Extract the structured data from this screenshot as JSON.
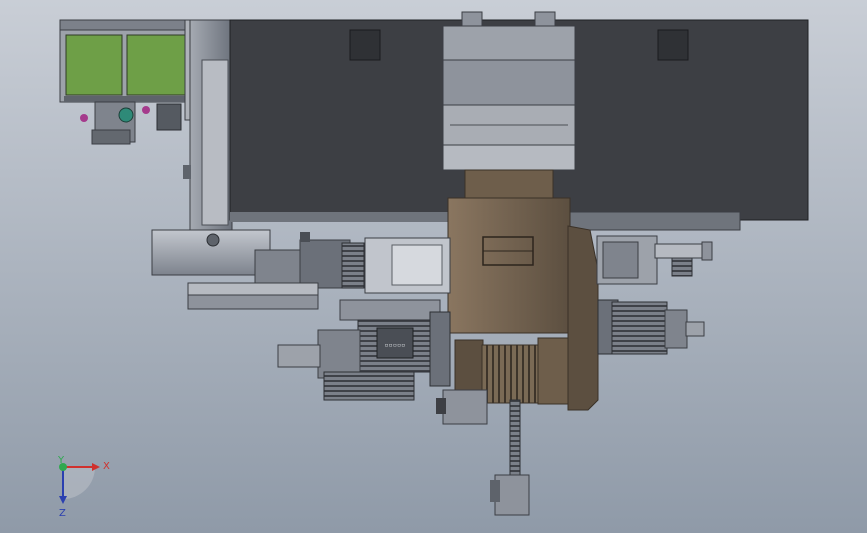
{
  "viewport": {
    "background_top": "#c9ced6",
    "background_bottom": "#8f9aa8"
  },
  "triad": {
    "x_label": "X",
    "y_label": "Y",
    "z_label": "Z",
    "x_color": "#d0312d",
    "y_color": "#2fa84f",
    "z_color": "#2a3fb0"
  },
  "colors": {
    "housing_dark": "#3d3f44",
    "housing_steel": "#8e939c",
    "housing_light": "#b6bac1",
    "gearbox_brown": "#6e5e4b",
    "gearbox_brown_dark": "#4e4336",
    "panel_green": "#6e9f47",
    "fitting_teal": "#2e8a78",
    "fitting_magenta": "#a53a8c"
  },
  "nameplate": {
    "text": "▫▫▫▫▫"
  }
}
